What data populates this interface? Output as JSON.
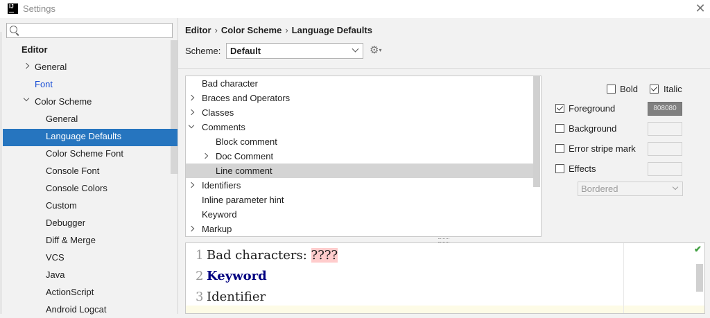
{
  "window": {
    "title": "Settings",
    "app_icon_text": "IJ",
    "close_icon": "close-icon"
  },
  "search": {
    "placeholder": ""
  },
  "sidebar": {
    "items": [
      {
        "label": "Editor",
        "level": 0,
        "bold": true,
        "chevron": "none"
      },
      {
        "label": "General",
        "level": 1,
        "chevron": "right"
      },
      {
        "label": "Font",
        "level": 1,
        "chevron": "none",
        "color": "#1a4fd6"
      },
      {
        "label": "Color Scheme",
        "level": 1,
        "chevron": "down"
      },
      {
        "label": "General",
        "level": 2
      },
      {
        "label": "Language Defaults",
        "level": 2,
        "selected": true
      },
      {
        "label": "Color Scheme Font",
        "level": 2
      },
      {
        "label": "Console Font",
        "level": 2
      },
      {
        "label": "Console Colors",
        "level": 2
      },
      {
        "label": "Custom",
        "level": 2
      },
      {
        "label": "Debugger",
        "level": 2
      },
      {
        "label": "Diff & Merge",
        "level": 2
      },
      {
        "label": "VCS",
        "level": 2
      },
      {
        "label": "Java",
        "level": 2
      },
      {
        "label": "ActionScript",
        "level": 2
      },
      {
        "label": "Android Logcat",
        "level": 2
      }
    ]
  },
  "breadcrumb": [
    "Editor",
    "Color Scheme",
    "Language Defaults"
  ],
  "breadcrumb_sep": "›",
  "scheme": {
    "label": "Scheme:",
    "value": "Default",
    "gear_icon": "gear-icon"
  },
  "attributes": [
    {
      "label": "Bad character",
      "indent": 0,
      "chevron": "none"
    },
    {
      "label": "Braces and Operators",
      "indent": 0,
      "chevron": "right"
    },
    {
      "label": "Classes",
      "indent": 0,
      "chevron": "right"
    },
    {
      "label": "Comments",
      "indent": 0,
      "chevron": "down"
    },
    {
      "label": "Block comment",
      "indent": 1,
      "chevron": "none"
    },
    {
      "label": "Doc Comment",
      "indent": 1,
      "chevron": "right"
    },
    {
      "label": "Line comment",
      "indent": 1,
      "chevron": "none",
      "selected": true
    },
    {
      "label": "Identifiers",
      "indent": 0,
      "chevron": "right"
    },
    {
      "label": "Inline parameter hint",
      "indent": 0,
      "chevron": "none"
    },
    {
      "label": "Keyword",
      "indent": 0,
      "chevron": "none"
    },
    {
      "label": "Markup",
      "indent": 0,
      "chevron": "right"
    }
  ],
  "options": {
    "bold": {
      "label": "Bold",
      "checked": false
    },
    "italic": {
      "label": "Italic",
      "checked": true
    },
    "foreground": {
      "label": "Foreground",
      "checked": true,
      "value": "808080"
    },
    "background": {
      "label": "Background",
      "checked": false
    },
    "error_stripe": {
      "label": "Error stripe mark",
      "checked": false
    },
    "effects": {
      "label": "Effects",
      "checked": false,
      "type": "Bordered"
    }
  },
  "preview": {
    "lines": [
      {
        "num": "1",
        "prefix": "Bad characters: ",
        "highlight": "????"
      },
      {
        "num": "2",
        "keyword": "Keyword"
      },
      {
        "num": "3",
        "text": "Identifier"
      }
    ],
    "status_icon": "checkmark-icon"
  },
  "colors": {
    "selection": "#2675bf",
    "keyword": "#000080",
    "bad_char_bg": "#ffcccc",
    "link": "#1a4fd6"
  }
}
